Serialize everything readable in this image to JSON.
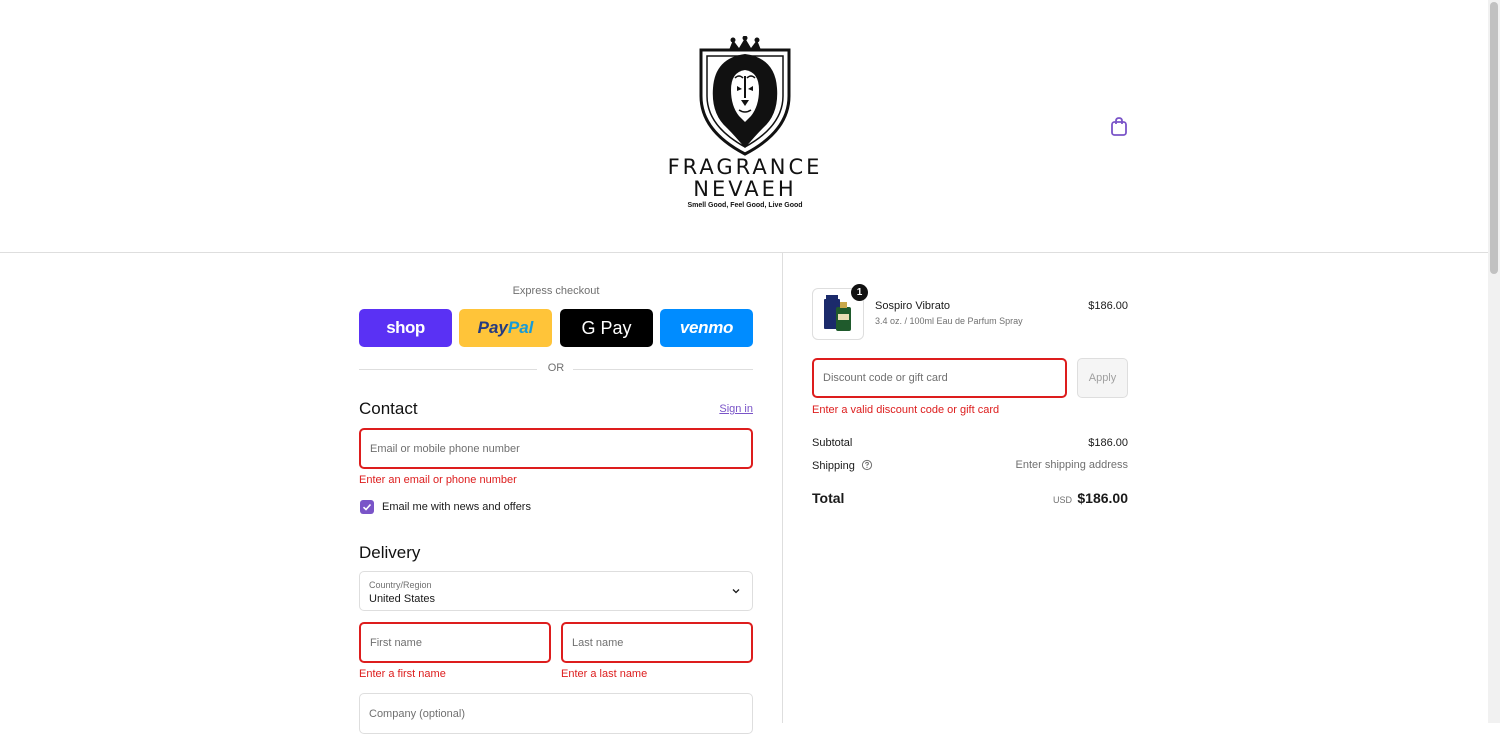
{
  "header": {
    "brand_line1": "FRAGRANCE",
    "brand_line2": "NEVAEH",
    "tagline": "Smell Good, Feel Good, Live Good",
    "cart_icon": "shopping-bag-icon"
  },
  "express": {
    "title": "Express checkout",
    "buttons": [
      {
        "label": "shop",
        "color": "#5a31f4"
      },
      {
        "label_a": "Pay",
        "label_b": "Pal",
        "color": "#ffc439"
      },
      {
        "label": "G Pay",
        "color": "#000000"
      },
      {
        "label": "venmo",
        "color": "#008cff"
      }
    ],
    "or": "OR"
  },
  "contact": {
    "title": "Contact",
    "sign_in": "Sign in",
    "email_placeholder": "Email or mobile phone number",
    "email_error": "Enter an email or phone number",
    "newsletter_label": "Email me with news and offers",
    "newsletter_checked": true
  },
  "delivery": {
    "title": "Delivery",
    "country_label": "Country/Region",
    "country_value": "United States",
    "first_name_placeholder": "First name",
    "first_name_error": "Enter a first name",
    "last_name_placeholder": "Last name",
    "last_name_error": "Enter a last name",
    "company_placeholder": "Company (optional)"
  },
  "order": {
    "item": {
      "quantity": "1",
      "name": "Sospiro Vibrato",
      "description": "3.4 oz. / 100ml Eau de Parfum Spray",
      "price": "$186.00"
    },
    "discount_placeholder": "Discount code or gift card",
    "apply_label": "Apply",
    "discount_error": "Enter a valid discount code or gift card",
    "subtotal_label": "Subtotal",
    "subtotal_value": "$186.00",
    "shipping_label": "Shipping",
    "shipping_value": "Enter shipping address",
    "total_label": "Total",
    "total_currency": "USD",
    "total_value": "$186.00"
  },
  "colors": {
    "accent": "#7a54c8",
    "error": "#dd1d1d"
  }
}
